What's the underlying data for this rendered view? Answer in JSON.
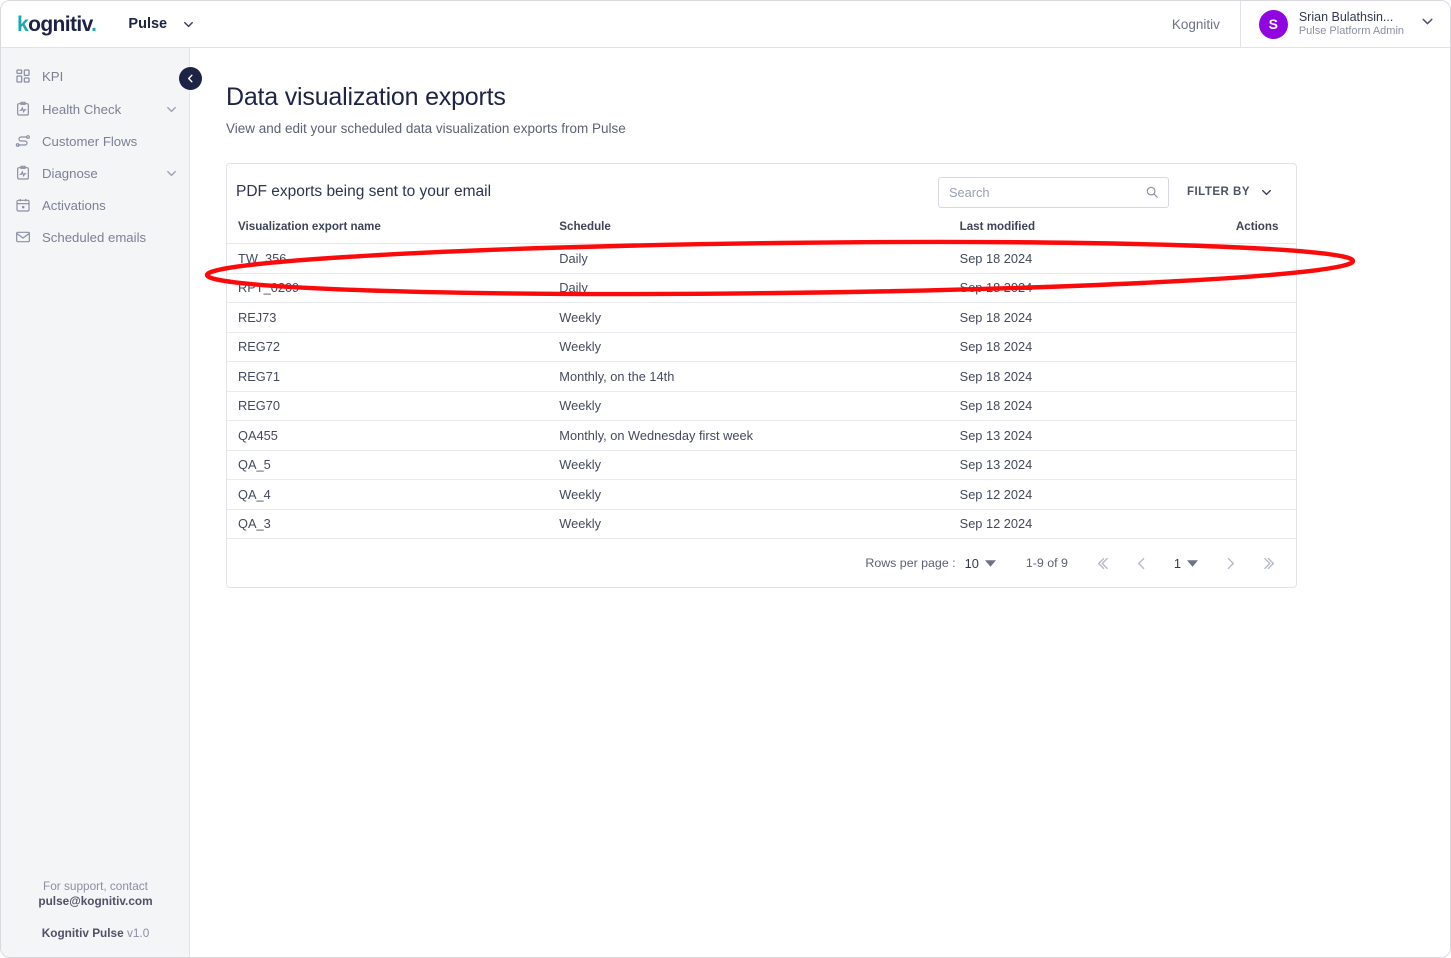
{
  "topbar": {
    "logo_k": "k",
    "logo_rest": "ognitiv",
    "logo_dot": ".",
    "product_name": "Pulse",
    "tenant": "Kognitiv",
    "avatar_initial": "S",
    "user_name": "Srian Bulathsin...",
    "user_role": "Pulse Platform Admin"
  },
  "sidebar": {
    "items": [
      {
        "label": "KPI",
        "icon": "grid-icon",
        "expandable": false
      },
      {
        "label": "Health Check",
        "icon": "clipboard-pulse-icon",
        "expandable": true
      },
      {
        "label": "Customer Flows",
        "icon": "flow-icon",
        "expandable": false
      },
      {
        "label": "Diagnose",
        "icon": "clipboard-pulse-icon",
        "expandable": true
      },
      {
        "label": "Activations",
        "icon": "calendar-icon",
        "expandable": false
      },
      {
        "label": "Scheduled emails",
        "icon": "envelope-icon",
        "expandable": false
      }
    ],
    "footer": {
      "support_line": "For support, contact",
      "support_email": "pulse@kognitiv.com",
      "app_name": "Kognitiv Pulse",
      "version": "v1.0"
    }
  },
  "page": {
    "title": "Data visualization exports",
    "subtitle": "View and edit your scheduled data visualization exports from Pulse"
  },
  "card": {
    "title": "PDF exports being sent to your email",
    "search": {
      "value": "",
      "placeholder": "Search"
    },
    "filter_label": "FILTER BY"
  },
  "table": {
    "columns": [
      "Visualization export name",
      "Schedule",
      "Last modified",
      "Actions"
    ],
    "rows": [
      {
        "name": "TW_356",
        "schedule": "Daily",
        "modified": "Sep 18 2024",
        "actions": ""
      },
      {
        "name": "RPT_0209",
        "schedule": "Daily",
        "modified": "Sep 18 2024",
        "actions": ""
      },
      {
        "name": "REJ73",
        "schedule": "Weekly",
        "modified": "Sep 18 2024",
        "actions": ""
      },
      {
        "name": "REG72",
        "schedule": "Weekly",
        "modified": "Sep 18 2024",
        "actions": ""
      },
      {
        "name": "REG71",
        "schedule": "Monthly, on the 14th",
        "modified": "Sep 18 2024",
        "actions": ""
      },
      {
        "name": "REG70",
        "schedule": "Weekly",
        "modified": "Sep 18 2024",
        "actions": ""
      },
      {
        "name": "QA455",
        "schedule": "Monthly, on Wednesday first week",
        "modified": "Sep 13 2024",
        "actions": ""
      },
      {
        "name": "QA_5",
        "schedule": "Weekly",
        "modified": "Sep 13 2024",
        "actions": ""
      },
      {
        "name": "QA_4",
        "schedule": "Weekly",
        "modified": "Sep 12 2024",
        "actions": ""
      },
      {
        "name": "QA_3",
        "schedule": "Weekly",
        "modified": "Sep 12 2024",
        "actions": ""
      }
    ]
  },
  "pagination": {
    "rows_per_page_label": "Rows per page :",
    "rows_per_page_value": "10",
    "range": "1-9 of 9",
    "page_value": "1"
  },
  "annotation": {
    "shape": "ellipse",
    "color": "#fa0a0a",
    "target_row": "TW_356"
  },
  "colors": {
    "brand_teal": "#1aa9ae",
    "brand_navy": "#1d2344",
    "avatar_purple": "#9105e0",
    "annotation_red": "#fa0a0a",
    "sidebar_bg": "#f4f5f7",
    "border": "#e2e3e8"
  }
}
